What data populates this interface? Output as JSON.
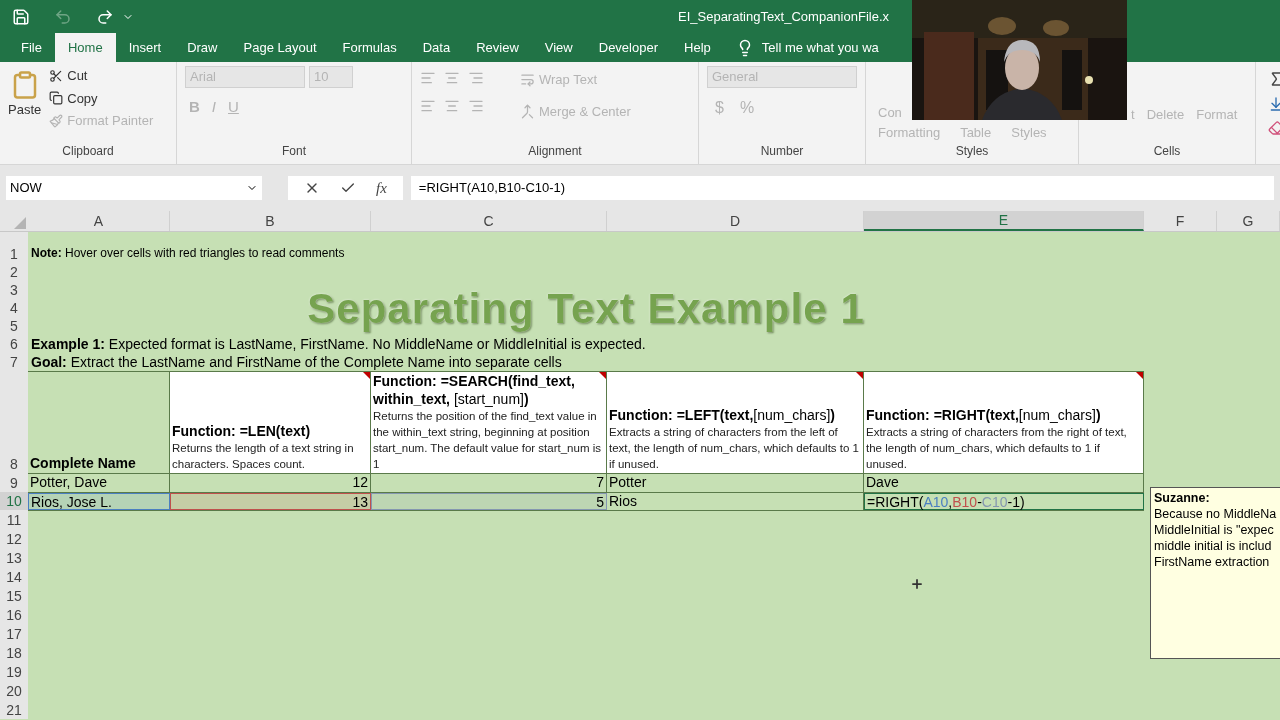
{
  "title_bar": {
    "title": "EI_SeparatingText_CompanionFile.x"
  },
  "ribbon_tabs": [
    {
      "label": "File",
      "selected": false
    },
    {
      "label": "Home",
      "selected": true
    },
    {
      "label": "Insert",
      "selected": false
    },
    {
      "label": "Draw",
      "selected": false
    },
    {
      "label": "Page Layout",
      "selected": false
    },
    {
      "label": "Formulas",
      "selected": false
    },
    {
      "label": "Data",
      "selected": false
    },
    {
      "label": "Review",
      "selected": false
    },
    {
      "label": "View",
      "selected": false
    },
    {
      "label": "Developer",
      "selected": false
    },
    {
      "label": "Help",
      "selected": false
    }
  ],
  "tell_me": "Tell me what you wa",
  "ribbon_groups": [
    {
      "kind": "clipboard",
      "label": "Clipboard",
      "paste": "Paste",
      "items": [
        {
          "label": "Cut",
          "disabled": false
        },
        {
          "label": "Copy",
          "disabled": false
        },
        {
          "label": "Format Painter",
          "disabled": true
        }
      ]
    },
    {
      "kind": "font",
      "label": "Font",
      "disabled": true,
      "font": "Arial",
      "size": "10",
      "letters": [
        "B",
        "I",
        "U"
      ]
    },
    {
      "kind": "alignment",
      "label": "Alignment",
      "disabled": true,
      "items": [
        "Wrap Text",
        "Merge & Center"
      ]
    },
    {
      "kind": "number",
      "label": "Number",
      "disabled": true,
      "format": "General",
      "symbols": [
        "$",
        "%"
      ]
    },
    {
      "kind": "styles",
      "label": "Styles",
      "disabled": true,
      "items": [
        "Con",
        "Formatting",
        "Table",
        "Styles"
      ]
    },
    {
      "kind": "cells",
      "label": "Cells",
      "disabled": true,
      "items": [
        "t",
        "Delete",
        "Format"
      ]
    }
  ],
  "formula_bar": {
    "name_box": "NOW",
    "fx": "fx",
    "formula": "=RIGHT(A10,B10-C10-1)"
  },
  "columns": [
    {
      "label": "A",
      "selected": false
    },
    {
      "label": "B",
      "selected": false
    },
    {
      "label": "C",
      "selected": false
    },
    {
      "label": "D",
      "selected": false
    },
    {
      "label": "E",
      "selected": true
    },
    {
      "label": "F",
      "selected": false
    },
    {
      "label": "G",
      "selected": false
    }
  ],
  "rows": [
    {
      "number": "1",
      "selected": false
    },
    {
      "number": "2",
      "selected": false
    },
    {
      "number": "3",
      "selected": false
    },
    {
      "number": "4",
      "selected": false
    },
    {
      "number": "5",
      "selected": false
    },
    {
      "number": "6",
      "selected": false
    },
    {
      "number": "7",
      "selected": false
    },
    {
      "number": "8",
      "selected": false
    },
    {
      "number": "9",
      "selected": false
    },
    {
      "number": "10",
      "selected": true
    },
    {
      "number": "11",
      "selected": false
    },
    {
      "number": "12",
      "selected": false
    },
    {
      "number": "13",
      "selected": false
    },
    {
      "number": "14",
      "selected": false
    },
    {
      "number": "15",
      "selected": false
    },
    {
      "number": "16",
      "selected": false
    },
    {
      "number": "17",
      "selected": false
    },
    {
      "number": "18",
      "selected": false
    },
    {
      "number": "19",
      "selected": false
    },
    {
      "number": "20",
      "selected": false
    },
    {
      "number": "21",
      "selected": false
    }
  ],
  "sheet": {
    "note": "**Note:** Hover over cells with red triangles to read comments",
    "title": "Separating Text Example 1",
    "example": "**Example 1:** Expected format is LastName, FirstName. No MiddleName or MiddleInitial is expected.",
    "goal": "**Goal:** Extract the LastName and FirstName of the Complete Name into separate cells",
    "header_cells": [
      {
        "title": "**Complete Name**",
        "comment": false
      },
      {
        "title": "**Function:    =LEN(text)**",
        "description": "Returns the length of a text string in characters. Spaces count.",
        "comment": true
      },
      {
        "title": "**Function:    =SEARCH(find_text, within_text,** [start_num]**)**",
        "description": "Returns the position of the find_text value in the within_text string, beginning at position start_num. The default value for start_num is 1",
        "comment": true
      },
      {
        "title": "**Function:  =LEFT(text,**[num_chars]**)**",
        "description": "Extracts a string of characters from the left of text, the length of num_chars, which defaults to 1 if unused.",
        "comment": true
      },
      {
        "title": "**Function:    =RIGHT(text,**[num_chars]**)**",
        "description": "Extracts a string of characters from the right of text, the length of num_chars, which defaults to 1 if unused.",
        "comment": true
      }
    ],
    "data_rows": [
      [
        {
          "kind": "text",
          "text": "Potter, Dave"
        },
        {
          "kind": "number",
          "text": "12"
        },
        {
          "kind": "number",
          "text": "7"
        },
        {
          "kind": "text",
          "text": "Potter"
        },
        {
          "kind": "text",
          "text": "Dave"
        }
      ],
      [
        {
          "kind": "text",
          "text": "Rios, Jose L.",
          "color": "#4a7fc1"
        },
        {
          "kind": "number",
          "text": "13",
          "color": "#c0504d"
        },
        {
          "kind": "number",
          "text": "5",
          "color": "#8497b0"
        },
        {
          "kind": "text",
          "text": "Rios"
        },
        {
          "kind": "formula",
          "parts": [
            {
              "text": "=RIGHT("
            },
            {
              "text": "A10",
              "color": "#4a7fc1"
            },
            {
              "text": ","
            },
            {
              "text": "B10",
              "color": "#c0504d"
            },
            {
              "text": "-"
            },
            {
              "text": "C10",
              "color": "#8497b0"
            },
            {
              "text": "-1)"
            }
          ]
        }
      ]
    ]
  },
  "comment": {
    "author": "Suzanne:",
    "lines": [
      "Because no MiddleNa",
      "MiddleInitial is \"expec",
      "middle initial is includ",
      "FirstName extraction"
    ]
  }
}
